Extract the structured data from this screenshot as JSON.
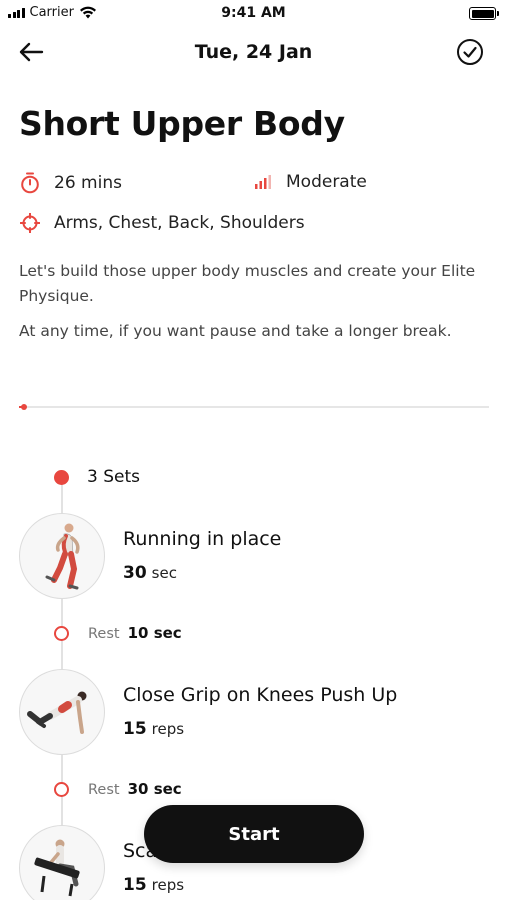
{
  "status_bar": {
    "carrier": "Carrier",
    "time": "9:41 AM"
  },
  "nav": {
    "title": "Tue, 24 Jan",
    "back_icon": "arrow-left-icon",
    "done_icon": "check-circle-icon"
  },
  "workout": {
    "title": "Short Upper Body",
    "duration": "26 mins",
    "difficulty": "Moderate",
    "muscles": "Arms, Chest, Back, Shoulders",
    "description_1": "Let's build those upper body muscles and create your Elite Physique.",
    "description_2": "At any time, if you want pause and take a longer break."
  },
  "progress": {
    "value": 0.01
  },
  "colors": {
    "accent": "#e8473f",
    "button": "#111111"
  },
  "timeline": {
    "sets_label": "3 Sets",
    "exercises": [
      {
        "name": "Running in place",
        "amount": "30",
        "unit": "sec"
      },
      {
        "name": "Close Grip on Knees Push Up",
        "amount": "15",
        "unit": "reps"
      },
      {
        "name": "Sca",
        "amount": "15",
        "unit": "reps"
      }
    ],
    "rests": [
      {
        "label": "Rest",
        "value": "10 sec"
      },
      {
        "label": "Rest",
        "value": "30 sec"
      }
    ]
  },
  "start_button": {
    "label": "Start"
  }
}
